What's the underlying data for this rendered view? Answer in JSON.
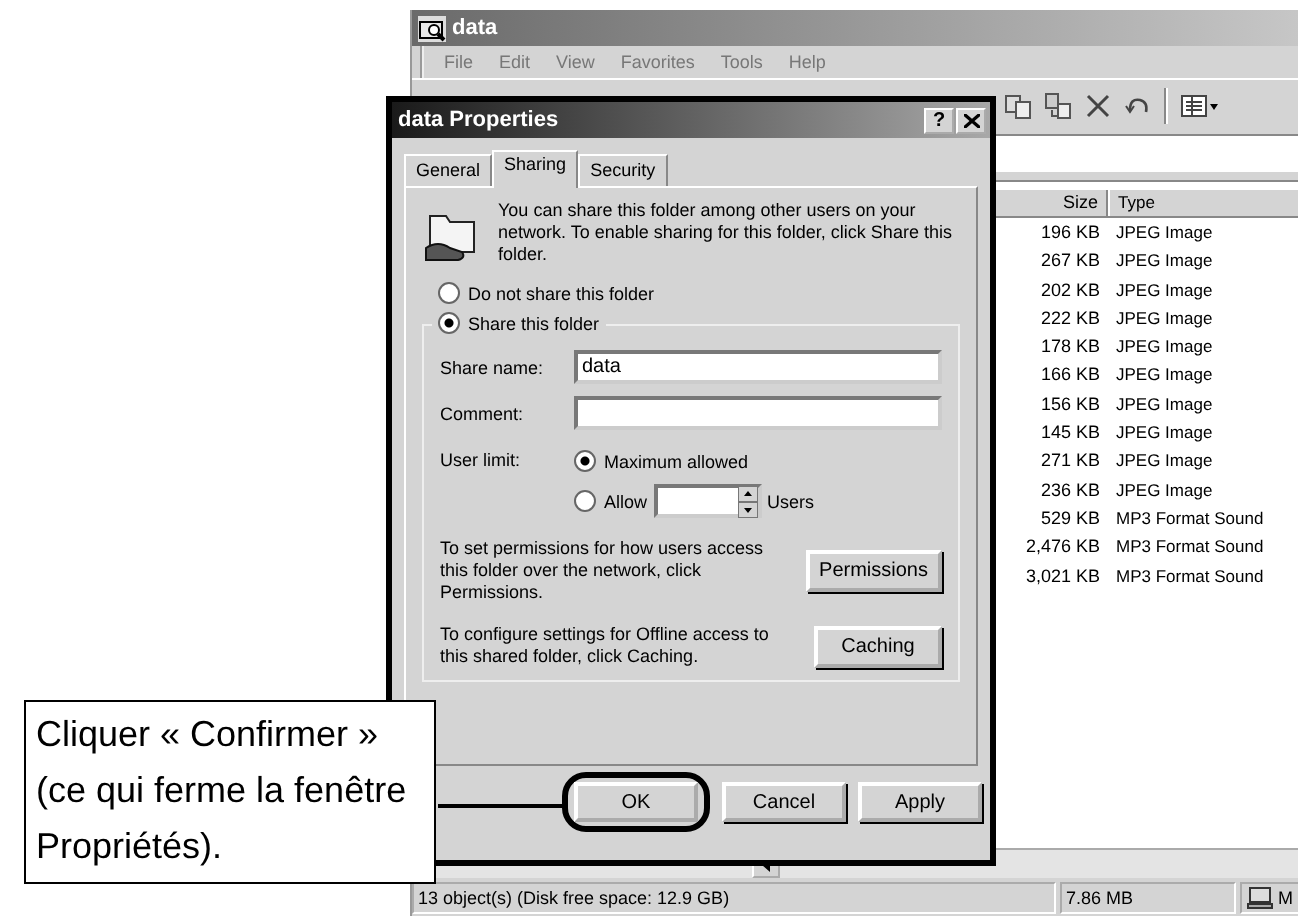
{
  "explorer": {
    "title": "data",
    "menu": [
      "File",
      "Edit",
      "View",
      "Favorites",
      "Tools",
      "Help"
    ],
    "columns": [
      "Size",
      "Type"
    ],
    "rows": [
      {
        "size": "196 KB",
        "type": "JPEG Image"
      },
      {
        "size": "267 KB",
        "type": "JPEG Image"
      },
      {
        "size": "202 KB",
        "type": "JPEG Image"
      },
      {
        "size": "222 KB",
        "type": "JPEG Image"
      },
      {
        "size": "178 KB",
        "type": "JPEG Image"
      },
      {
        "size": "166 KB",
        "type": "JPEG Image"
      },
      {
        "size": "156 KB",
        "type": "JPEG Image"
      },
      {
        "size": "145 KB",
        "type": "JPEG Image"
      },
      {
        "size": "271 KB",
        "type": "JPEG Image"
      },
      {
        "size": "236 KB",
        "type": "JPEG Image"
      },
      {
        "size": "529 KB",
        "type": "MP3 Format Sound"
      },
      {
        "size": "2,476 KB",
        "type": "MP3 Format Sound"
      },
      {
        "size": "3,021 KB",
        "type": "MP3 Format Sound"
      }
    ],
    "status_bar": {
      "objects": "13 object(s) (Disk free space: 12.9 GB)",
      "size": "7.86 MB",
      "zone": "M"
    }
  },
  "dialog": {
    "title": "data Properties",
    "help_button": "?",
    "tabs": [
      {
        "label": "General",
        "selected": false
      },
      {
        "label": "Sharing",
        "selected": true
      },
      {
        "label": "Security",
        "selected": false
      }
    ],
    "intro": "You can share this folder among other users on your network.  To enable sharing for this folder, click Share this folder.",
    "share_options": [
      {
        "label": "Do not share this folder",
        "selected": false
      },
      {
        "label": "Share this folder",
        "selected": true
      }
    ],
    "share_name": {
      "label": "Share name:",
      "value": "data"
    },
    "comment": {
      "label": "Comment:"
    },
    "user_limit": {
      "label": "User limit:",
      "options": [
        {
          "label": "Maximum allowed",
          "selected": true
        },
        {
          "label": "Allow",
          "selected": false
        }
      ],
      "unit": "Users"
    },
    "permissions": {
      "text": "To set permissions for how users access this folder over the network, click Permissions.",
      "button": "Permissions"
    },
    "caching": {
      "text": "To configure settings for Offline access to this shared folder, click Caching.",
      "button": "Caching"
    },
    "buttons": [
      {
        "label": "OK",
        "highlighted": true
      },
      {
        "label": "Cancel",
        "highlighted": false
      },
      {
        "label": "Apply",
        "highlighted": false
      }
    ]
  },
  "callout": {
    "text": "Cliquer « Confirmer » (ce qui ferme la fenêtre Propriétés)."
  }
}
